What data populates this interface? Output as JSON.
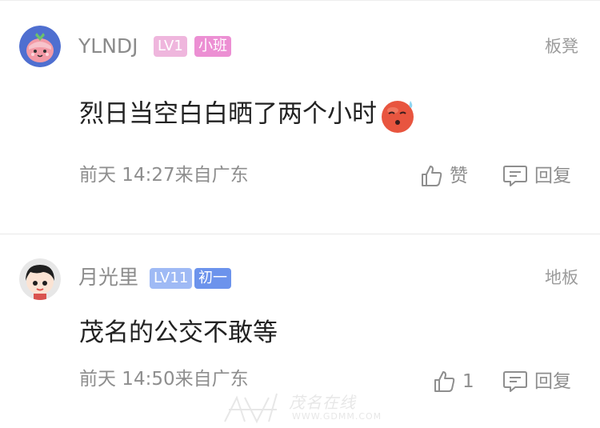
{
  "comments": [
    {
      "username": "YLNDJ",
      "level": "LV1",
      "grade": "小班",
      "floor": "板凳",
      "content": "烈日当空白白晒了两个小时",
      "meta": "前天 14:27来自广东",
      "like_label": "赞",
      "reply_label": "回复",
      "emoji": "hot-face-emoji"
    },
    {
      "username": "月光里",
      "level": "LV11",
      "grade": "初一",
      "floor": "地板",
      "content": "茂名的公交不敢等",
      "meta": "前天 14:50来自广东",
      "like_label": "1",
      "reply_label": "回复"
    }
  ],
  "watermark": {
    "text": "茂名在线",
    "url": "WWW.GDMM.COM"
  },
  "colors": {
    "lv1_badge": "#efb6dd",
    "grade1_badge": "#ec8fd3",
    "lv11_badge": "#9fbaf5",
    "grade2_badge": "#6c93ec"
  }
}
